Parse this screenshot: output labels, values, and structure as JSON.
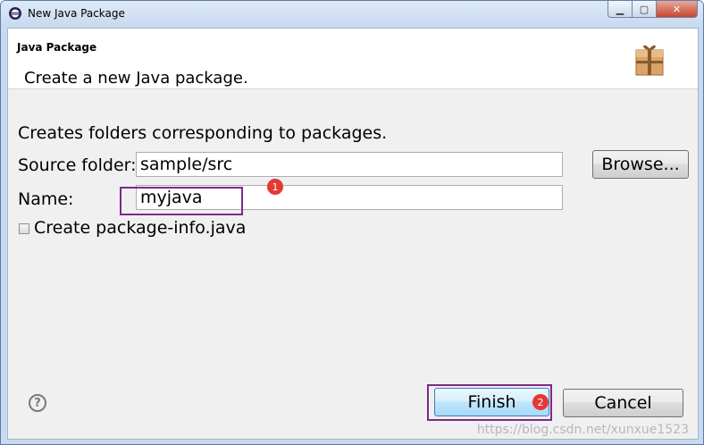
{
  "window": {
    "title": "New Java Package"
  },
  "header": {
    "title": "Java Package",
    "description": "Create a new Java package."
  },
  "form": {
    "intro": "Creates folders corresponding to packages.",
    "source_folder_label": "Source folder:",
    "source_folder_value": "sample/src",
    "browse_label": "Browse...",
    "name_label": "Name:",
    "name_value": "myjava",
    "create_package_info_label": "Create package-info.java",
    "create_package_info_checked": false
  },
  "footer": {
    "help_glyph": "?",
    "finish_label": "Finish",
    "cancel_label": "Cancel"
  },
  "annotations": {
    "badge_1": "1",
    "badge_2": "2",
    "highlight_color": "#7b2a8a",
    "badge_color": "#e53935"
  },
  "watermark": "https://blog.csdn.net/xunxue1523"
}
